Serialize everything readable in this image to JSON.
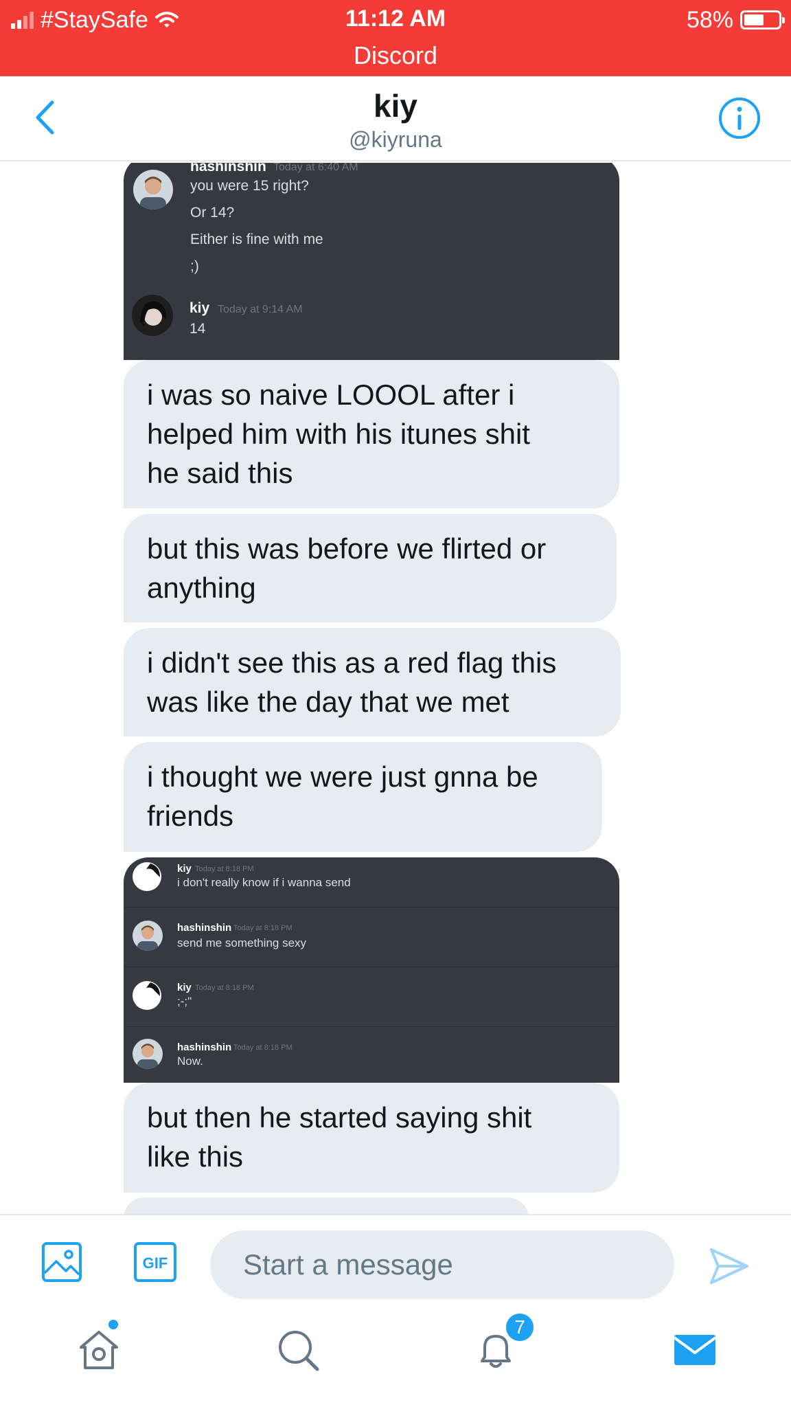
{
  "status_bar": {
    "carrier": "#StaySafe",
    "time": "11:12 AM",
    "app_return": "Discord",
    "battery": "58%",
    "battery_level": 0.58,
    "background_color": "#f53b36"
  },
  "header": {
    "title": "kiy",
    "handle": "@kiyruna",
    "back_icon": "chevron-left-icon",
    "info_icon": "info-icon",
    "accent_color": "#1da1f2"
  },
  "screenshot_1": {
    "first": {
      "name": "hashinshin",
      "time": "Today at 6:40 AM",
      "lines": [
        "you were 15 right?",
        "Or 14?",
        "Either is fine with me",
        ";)"
      ]
    },
    "second": {
      "name": "kiy",
      "time": "Today at 9:14 AM",
      "lines": [
        "14"
      ]
    }
  },
  "messages": [
    {
      "lines": [
        "i was so naive LOOOL after i",
        "helped him with his itunes shit",
        "he said this"
      ]
    },
    {
      "lines": [
        "but this was before we flirted or",
        "anything"
      ]
    },
    {
      "lines": [
        "i didn't see this as a red flag this",
        "was like the day that we met"
      ]
    },
    {
      "lines": [
        "i thought we were just gnna be",
        "friends"
      ]
    },
    {
      "lines": [
        "but then he started saying shit",
        "like this"
      ]
    }
  ],
  "screenshot_2": {
    "entries": [
      {
        "name": "kiy",
        "time": "Today at 8:18 PM",
        "text": "i don't really know if i wanna send"
      },
      {
        "name": "hashinshin",
        "time": "Today at 8:18 PM",
        "text": "send me something sexy"
      },
      {
        "name": "kiy",
        "time": "Today at 8:18 PM",
        "text": ";-;\""
      },
      {
        "name": "hashinshin",
        "time": "Today at 8:18 PM",
        "text": "Now."
      }
    ]
  },
  "composer": {
    "placeholder": "Start a message",
    "gif_label": "GIF"
  },
  "tabbar": {
    "items": [
      "home-icon",
      "search-icon",
      "notifications-icon",
      "messages-icon"
    ],
    "notifications_badge": "7"
  }
}
